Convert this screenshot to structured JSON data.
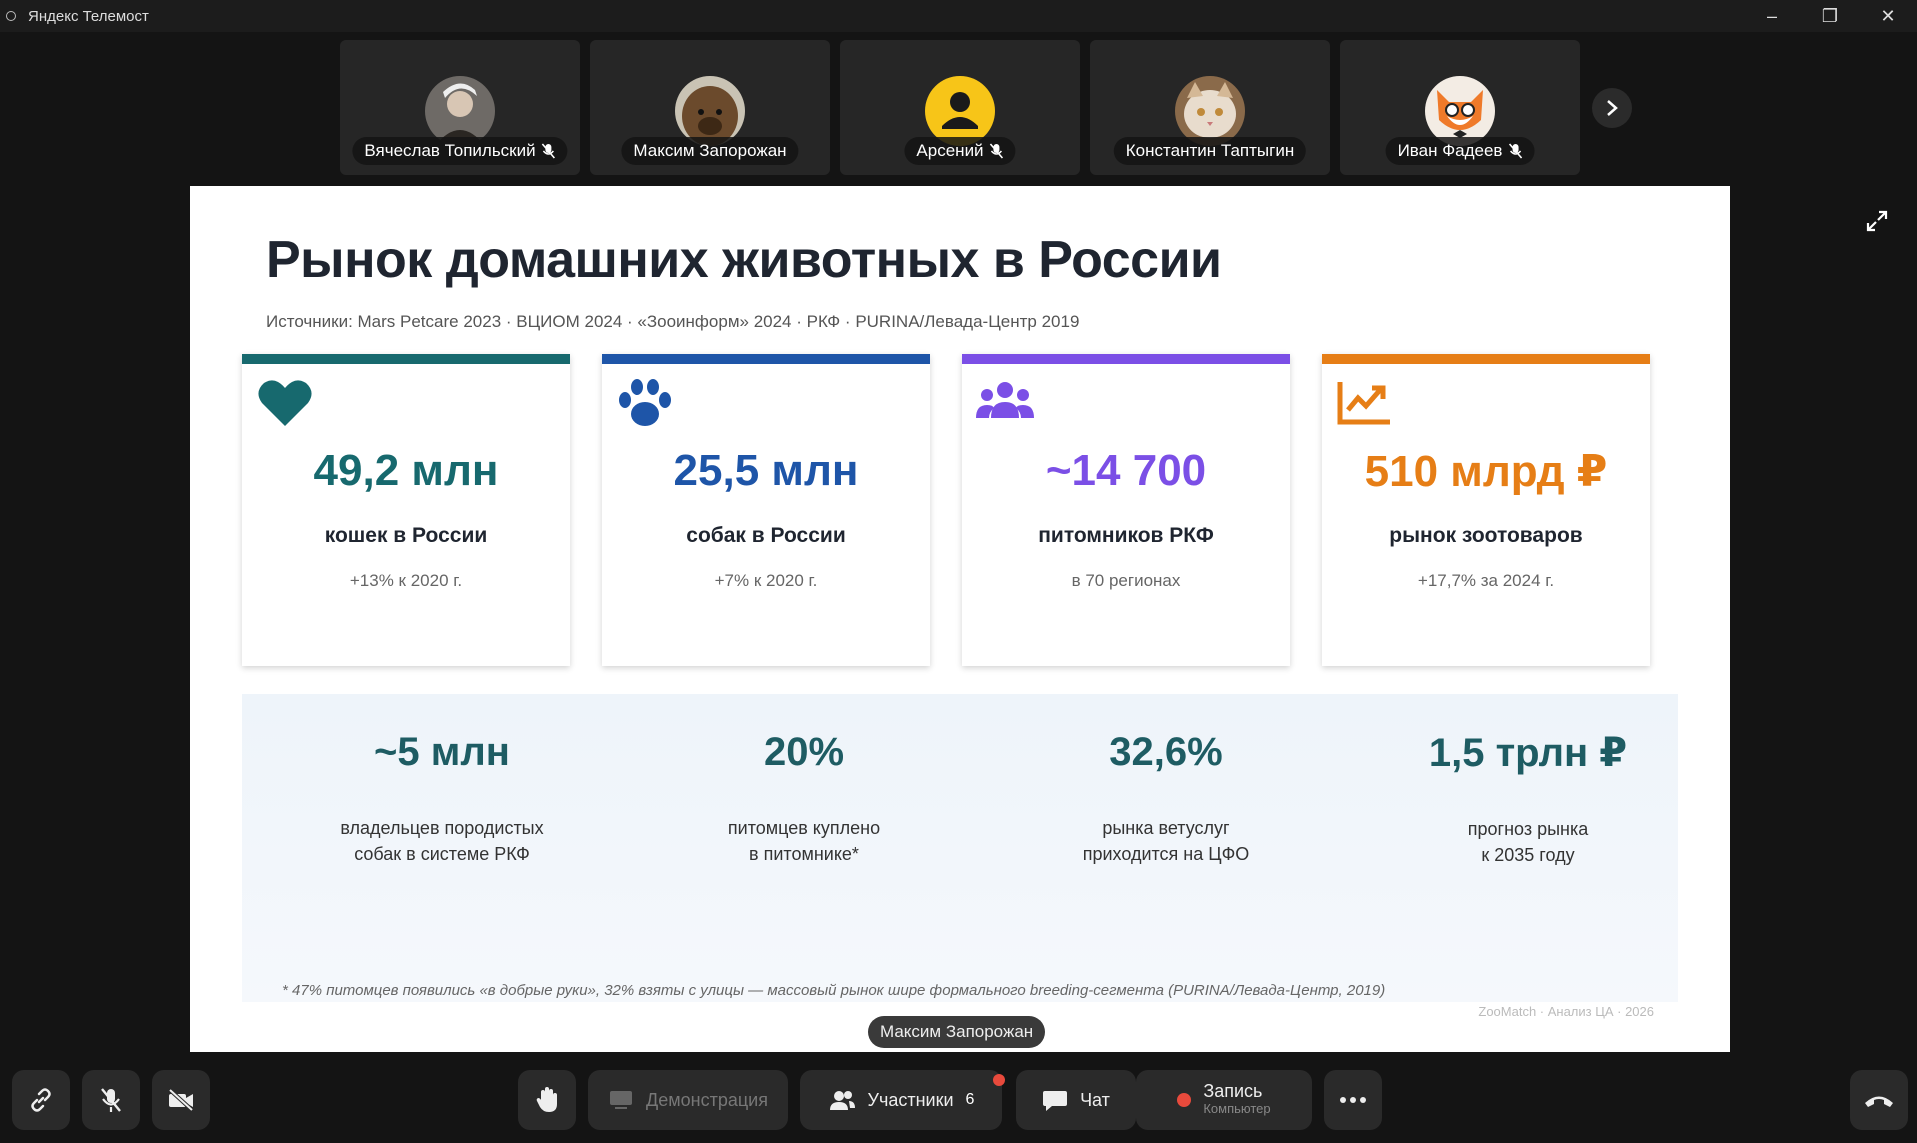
{
  "window": {
    "title": "Яндекс Телемост",
    "minimize_icon": "–",
    "restore_icon": "❐",
    "close_icon": "✕"
  },
  "participants": [
    {
      "name": "Вячеслав Топильский",
      "muted": true
    },
    {
      "name": "Максим Запорожан",
      "muted": false
    },
    {
      "name": "Арсений",
      "muted": true
    },
    {
      "name": "Константин Таптыгин",
      "muted": false
    },
    {
      "name": "Иван Фадеев",
      "muted": true
    }
  ],
  "slide": {
    "title": "Рынок домашних животных в России",
    "sources": "Источники: Mars Petcare 2023 · ВЦИОМ 2024 · «Зооинформ» 2024 · РКФ · PURINA/Левада-Центр 2019",
    "cards": [
      {
        "value": "49,2 млн",
        "label": "кошек в России",
        "sub": "+13% к 2020 г.",
        "color": "#17696e",
        "icon": "heart-icon"
      },
      {
        "value": "25,5 млн",
        "label": "собак в России",
        "sub": "+7% к 2020 г.",
        "color": "#1e55a8",
        "icon": "paw-icon"
      },
      {
        "value": "~14 700",
        "label": "питомников РКФ",
        "sub": "в 70 регионах",
        "color": "#7b4fe6",
        "icon": "users-icon"
      },
      {
        "value": "510 млрд ₽",
        "label": "рынок зоотоваров",
        "sub": "+17,7% за 2024 г.",
        "color": "#e67e16",
        "icon": "trend-chart-icon"
      }
    ],
    "stats": [
      {
        "value": "~5 млн",
        "line1": "владельцев породистых",
        "line2": "собак в системе РКФ"
      },
      {
        "value": "20%",
        "line1": "питомцев куплено",
        "line2": "в питомнике*"
      },
      {
        "value": "32,6%",
        "line1": "рынка ветуслуг",
        "line2": "приходится на ЦФО"
      },
      {
        "value": "1,5 трлн ₽",
        "line1": "прогноз рынка",
        "line2": "к 2035 году"
      }
    ],
    "footnote": "* 47% питомцев появились «в добрые руки», 32% взяты с улицы — массовый рынок шире формального breeding-сегмента (PURINA/Левада-Центр, 2019)",
    "brand": "ZooMatch · Анализ ЦА · 2026"
  },
  "speaker": "Максим Запорожан",
  "toolbar": {
    "demo_label": "Демонстрация",
    "participants_label": "Участники",
    "participants_count": "6",
    "chat_label": "Чат",
    "record_label": "Запись",
    "record_sub": "Компьютер"
  },
  "colors": {
    "accent_teal": "#17696e",
    "accent_blue": "#1e55a8",
    "accent_purple": "#7b4fe6",
    "accent_orange": "#e67e16",
    "record_red": "#e84a3c",
    "hangup_bg": "#2a2a2a"
  }
}
